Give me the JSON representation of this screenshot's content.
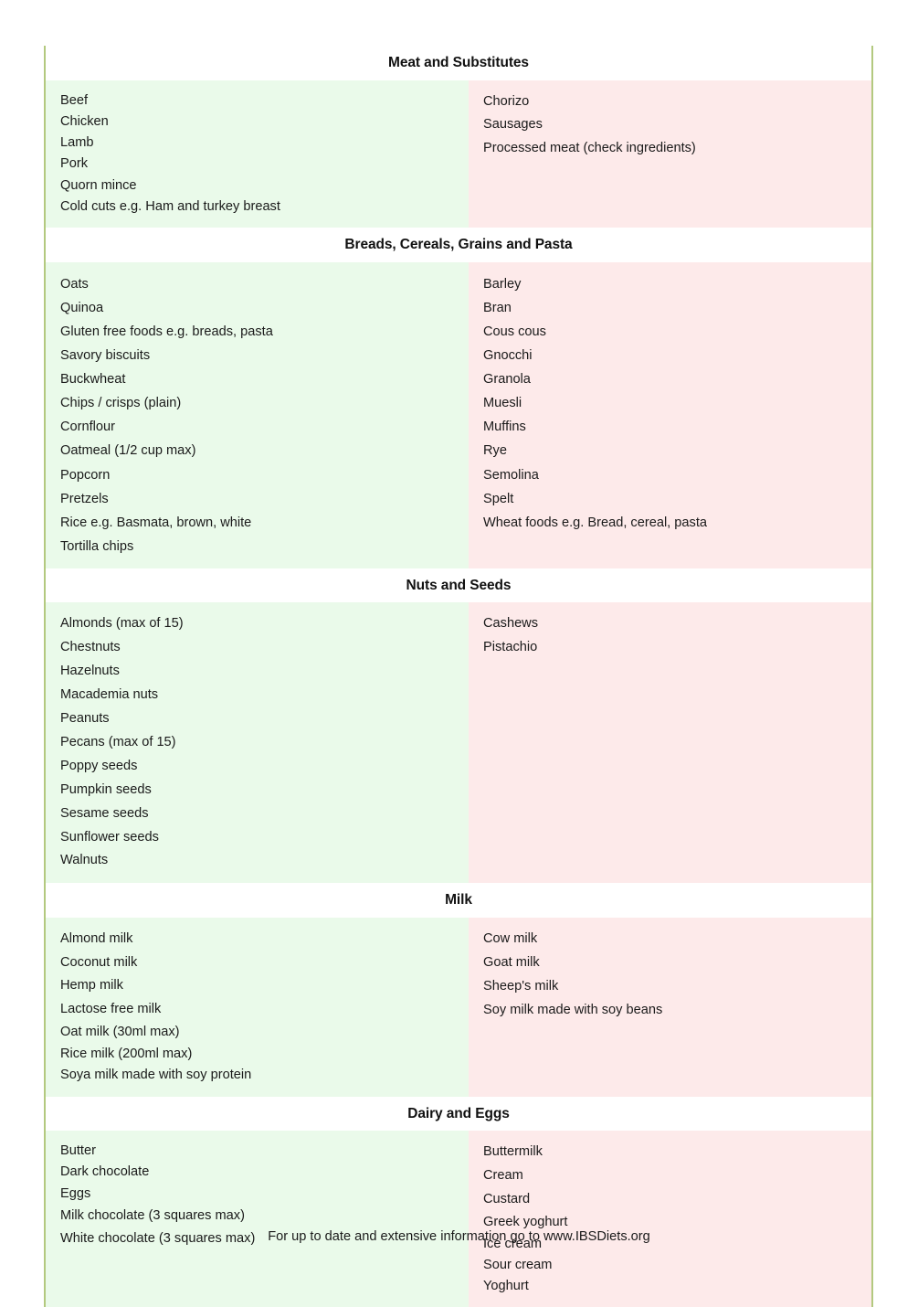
{
  "document": {
    "footer_note": "For up to date and extensive information go to www.IBSDiets.org",
    "colors": {
      "allowed_background": "#eafaea",
      "avoid_background": "#fdeaea",
      "border": "#b3c97f",
      "text": "#1a1a1a"
    }
  },
  "sections": [
    {
      "title": "Meat and Substitutes",
      "allowed": [
        "Beef",
        "Chicken",
        "Lamb",
        "Pork",
        "Quorn mince",
        "Cold cuts e.g. Ham and turkey breast"
      ],
      "avoid": [
        "Chorizo",
        "Sausages",
        "Processed meat (check ingredients)"
      ]
    },
    {
      "title": "Breads, Cereals, Grains and Pasta",
      "allowed": [
        "Oats",
        "Quinoa",
        "Gluten free foods e.g. breads, pasta",
        "Savory biscuits",
        "Buckwheat",
        "Chips / crisps (plain)",
        "Cornflour",
        "Oatmeal (1/2 cup max)",
        "Popcorn",
        "Pretzels",
        "Rice e.g. Basmata, brown, white",
        "Tortilla chips"
      ],
      "avoid": [
        "Barley",
        "Bran",
        "Cous cous",
        "Gnocchi",
        "Granola",
        "Muesli",
        "Muffins",
        "Rye",
        "Semolina",
        "Spelt",
        "Wheat foods e.g. Bread, cereal, pasta"
      ]
    },
    {
      "title": "Nuts and Seeds",
      "allowed": [
        "Almonds (max of 15)",
        "Chestnuts",
        "Hazelnuts",
        "Macademia nuts",
        "Peanuts",
        "Pecans (max of 15)",
        "Poppy seeds",
        "Pumpkin seeds",
        "Sesame seeds",
        "Sunflower seeds",
        "Walnuts"
      ],
      "avoid": [
        "Cashews",
        "Pistachio"
      ]
    },
    {
      "title": "Milk",
      "allowed": [
        "Almond milk",
        "Coconut milk",
        "Hemp milk",
        "Lactose free milk",
        "Oat milk (30ml max)",
        "Rice milk (200ml max)",
        "Soya milk made with soy protein"
      ],
      "avoid": [
        "Cow milk",
        "Goat milk",
        "Sheep's milk",
        "Soy milk made with soy beans"
      ]
    },
    {
      "title": "Dairy and Eggs",
      "allowed": [
        "Butter",
        "Dark chocolate",
        "Eggs",
        "Milk chocolate (3 squares max)",
        "White chocolate (3 squares max)"
      ],
      "avoid": [
        "Buttermilk",
        "Cream",
        "Custard",
        "Greek yoghurt",
        "Ice cream",
        "Sour cream",
        "Yoghurt"
      ]
    }
  ]
}
